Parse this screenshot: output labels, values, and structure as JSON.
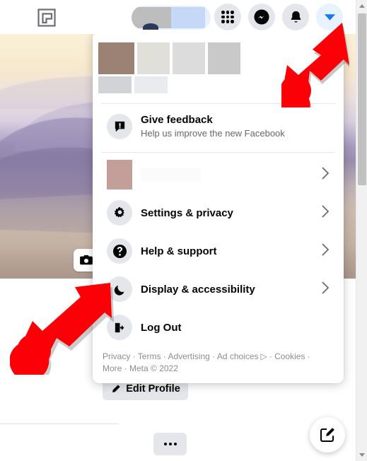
{
  "topbar": {
    "logo_name": "logo-mark-icon",
    "profile_pill_redacted": true,
    "buttons": [
      {
        "name": "menu-grid-button",
        "icon": "grid-icon",
        "label": "Menu"
      },
      {
        "name": "messenger-button",
        "icon": "messenger-icon",
        "label": "Messenger"
      },
      {
        "name": "notifications-button",
        "icon": "bell-icon",
        "label": "Notifications"
      },
      {
        "name": "account-dropdown-button",
        "icon": "chevron-down-icon",
        "label": "Account",
        "active": true,
        "active_bg": "#e7f3ff",
        "active_fg": "#1877f2"
      }
    ]
  },
  "cover": {
    "camera_button_label": "Edit cover photo",
    "camera_icon": "camera-icon"
  },
  "profile": {
    "edit_profile_label": "Edit Profile",
    "edit_profile_icon": "pencil-icon",
    "more_button_label": "...",
    "compose_fab_icon": "compose-icon"
  },
  "menu": {
    "header_redacted": true,
    "feedback": {
      "icon": "feedback-bubble-icon",
      "title": "Give feedback",
      "subtitle": "Help us improve the new Facebook"
    },
    "items": [
      {
        "name": "menu-item-redacted-account",
        "icon": "redacted-avatar",
        "label": "",
        "redacted": true,
        "chevron": "›"
      },
      {
        "name": "menu-item-settings-privacy",
        "icon": "gear-icon",
        "label": "Settings & privacy",
        "chevron": "›"
      },
      {
        "name": "menu-item-help-support",
        "icon": "question-mark-icon",
        "label": "Help & support",
        "chevron": "›"
      },
      {
        "name": "menu-item-display-accessibility",
        "icon": "moon-icon",
        "label": "Display & accessibility",
        "chevron": "›"
      },
      {
        "name": "menu-item-log-out",
        "icon": "logout-icon",
        "label": "Log Out",
        "chevron": ""
      }
    ],
    "footer": {
      "line1": "Privacy · Terms · Advertising · Ad choices",
      "adchoices_glyph": "▷",
      "line1b": "· Cookies ·",
      "line2": "More · Meta © 2022"
    }
  },
  "annotations": [
    {
      "name": "annotation-arrow-to-account-dropdown",
      "color": "#fb0007",
      "direction": "up-right",
      "target": "account-dropdown-button"
    },
    {
      "name": "annotation-arrow-to-display-accessibility",
      "color": "#fb0007",
      "direction": "up-right",
      "target": "menu-item-display-accessibility"
    }
  ],
  "scrollbar": {
    "up_arrow": "▲",
    "down_arrow": "▼",
    "thumb_name": "scrollbar-thumb"
  }
}
